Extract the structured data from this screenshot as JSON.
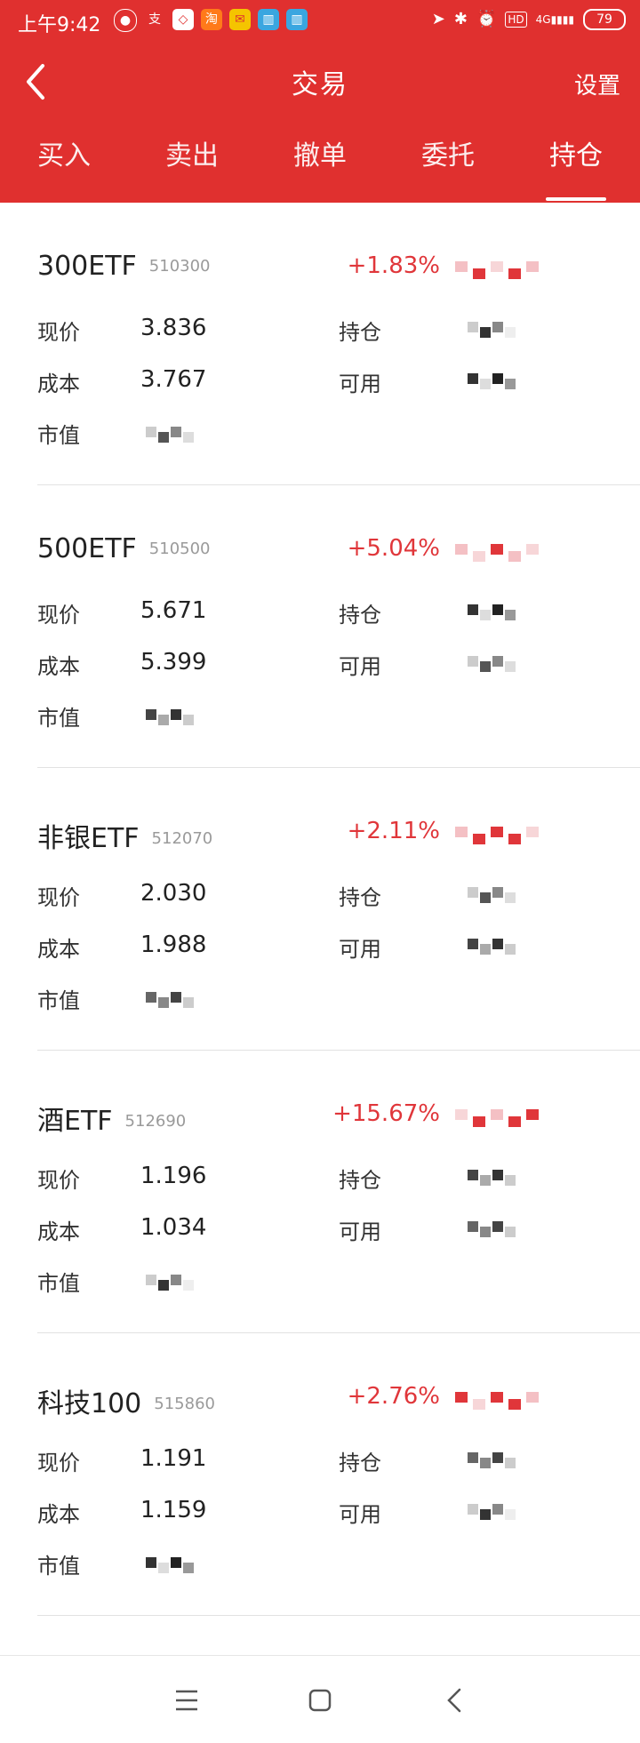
{
  "status_bar": {
    "time": "上午9:42",
    "battery": "79",
    "network": "4G",
    "hd": "HD"
  },
  "header": {
    "title": "交易",
    "settings": "设置"
  },
  "tabs": [
    {
      "label": "买入"
    },
    {
      "label": "卖出"
    },
    {
      "label": "撤单"
    },
    {
      "label": "委托"
    },
    {
      "label": "持仓"
    }
  ],
  "active_tab": "持仓",
  "labels": {
    "price": "现价",
    "cost": "成本",
    "market_value": "市值",
    "holding": "持仓",
    "available": "可用"
  },
  "holdings": [
    {
      "name": "300ETF",
      "code": "510300",
      "change": "+1.83%",
      "price": "3.836",
      "cost": "3.767"
    },
    {
      "name": "500ETF",
      "code": "510500",
      "change": "+5.04%",
      "price": "5.671",
      "cost": "5.399"
    },
    {
      "name": "非银ETF",
      "code": "512070",
      "change": "+2.11%",
      "price": "2.030",
      "cost": "1.988"
    },
    {
      "name": "酒ETF",
      "code": "512690",
      "change": "+15.67%",
      "price": "1.196",
      "cost": "1.034"
    },
    {
      "name": "科技100",
      "code": "515860",
      "change": "+2.76%",
      "price": "1.191",
      "cost": "1.159"
    }
  ],
  "colors": {
    "brand": "#e0302f",
    "gain": "#e0363a"
  }
}
